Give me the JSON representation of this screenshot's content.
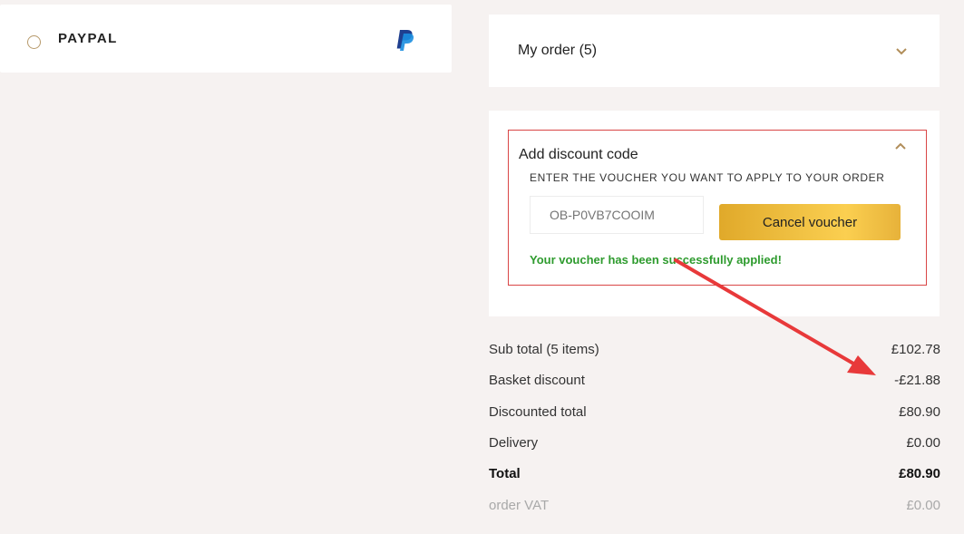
{
  "payment": {
    "option_label": "PAYPAL",
    "logo_icon": "paypal-logo-icon"
  },
  "order": {
    "title": "My order (5)",
    "toggle_icon": "chevron-down-icon"
  },
  "discount": {
    "title": "Add discount code",
    "toggle_icon": "chevron-up-icon",
    "caption": "ENTER THE VOUCHER YOU WANT TO APPLY TO YOUR ORDER",
    "input_placeholder": "OB-P0VB7COOIM",
    "button_label": "Cancel voucher",
    "success_message": "Your voucher has been successfully applied!"
  },
  "totals": [
    {
      "label": "Sub total (5 items)",
      "value": "£102.78"
    },
    {
      "label": "Basket discount",
      "value": "-£21.88"
    },
    {
      "label": "Discounted total",
      "value": "£80.90"
    },
    {
      "label": "Delivery",
      "value": "£0.00"
    },
    {
      "label": "Total",
      "value": "£80.90"
    },
    {
      "label": "order VAT",
      "value": "£0.00"
    }
  ],
  "colors": {
    "background": "#f6f2f1",
    "accent_gold": "#f1c244",
    "success_green": "#2e9b2e",
    "highlight_red": "#d94646",
    "annotation_arrow": "#e8393a"
  }
}
